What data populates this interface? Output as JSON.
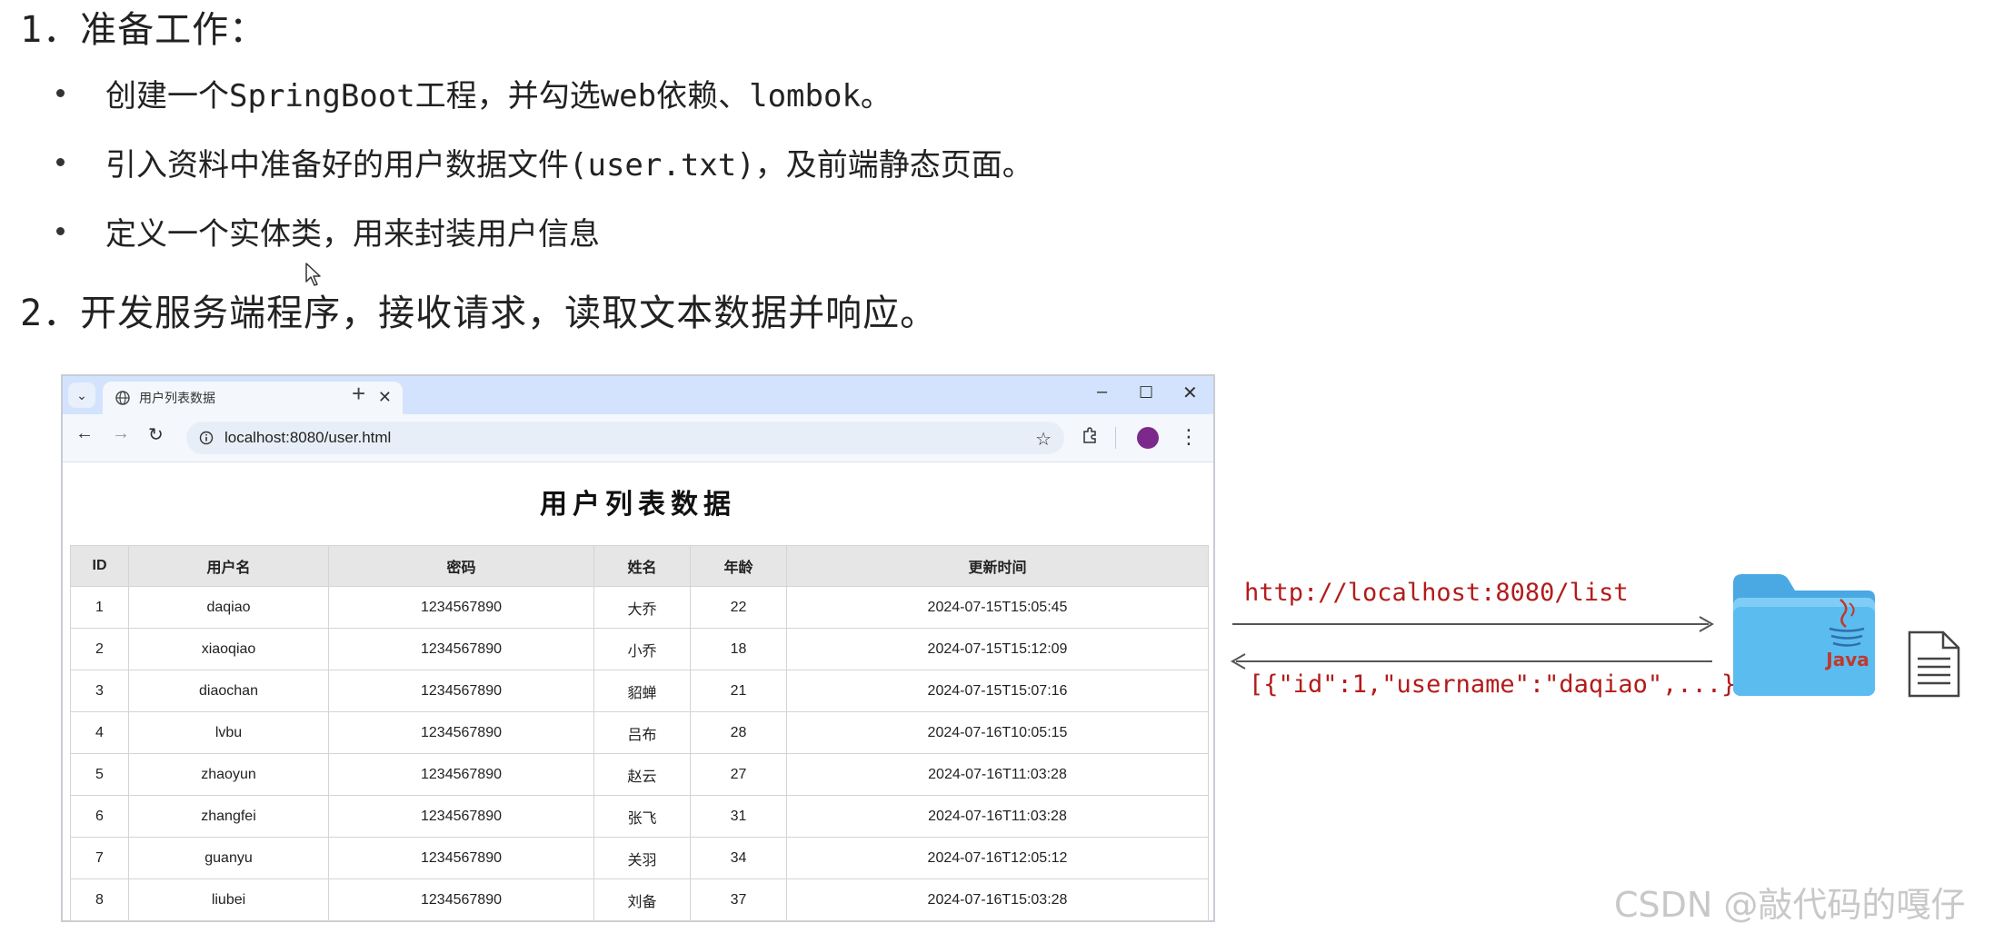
{
  "slide": {
    "heading1": "1．准备工作：",
    "bullets": [
      "创建一个SpringBoot工程，并勾选web依赖、lombok。",
      "引入资料中准备好的用户数据文件(user.txt)，及前端静态页面。",
      "定义一个实体类，用来封装用户信息"
    ],
    "heading2": "2．开发服务端程序，接收请求，读取文本数据并响应。"
  },
  "browser": {
    "tab_title": "用户列表数据",
    "url": "localhost:8080/user.html",
    "page_title": "用户列表数据",
    "table": {
      "headers": [
        "ID",
        "用户名",
        "密码",
        "姓名",
        "年龄",
        "更新时间"
      ],
      "rows": [
        [
          "1",
          "daqiao",
          "1234567890",
          "大乔",
          "22",
          "2024-07-15T15:05:45"
        ],
        [
          "2",
          "xiaoqiao",
          "1234567890",
          "小乔",
          "18",
          "2024-07-15T15:12:09"
        ],
        [
          "3",
          "diaochan",
          "1234567890",
          "貂蝉",
          "21",
          "2024-07-15T15:07:16"
        ],
        [
          "4",
          "lvbu",
          "1234567890",
          "吕布",
          "28",
          "2024-07-16T10:05:15"
        ],
        [
          "5",
          "zhaoyun",
          "1234567890",
          "赵云",
          "27",
          "2024-07-16T11:03:28"
        ],
        [
          "6",
          "zhangfei",
          "1234567890",
          "张飞",
          "31",
          "2024-07-16T11:03:28"
        ],
        [
          "7",
          "guanyu",
          "1234567890",
          "关羽",
          "34",
          "2024-07-16T12:05:12"
        ],
        [
          "8",
          "liubei",
          "1234567890",
          "刘备",
          "37",
          "2024-07-16T15:03:28"
        ]
      ]
    }
  },
  "diagram": {
    "request_url": "http://localhost:8080/list",
    "response": "[{\"id\":1,\"username\":\"daqiao\",...}]",
    "java_label": "Java",
    "colors": {
      "request_text": "#b31b1b",
      "folder": "#5bbcf0",
      "arrow": "#555555"
    }
  },
  "watermark": "CSDN @敲代码的嘎仔"
}
